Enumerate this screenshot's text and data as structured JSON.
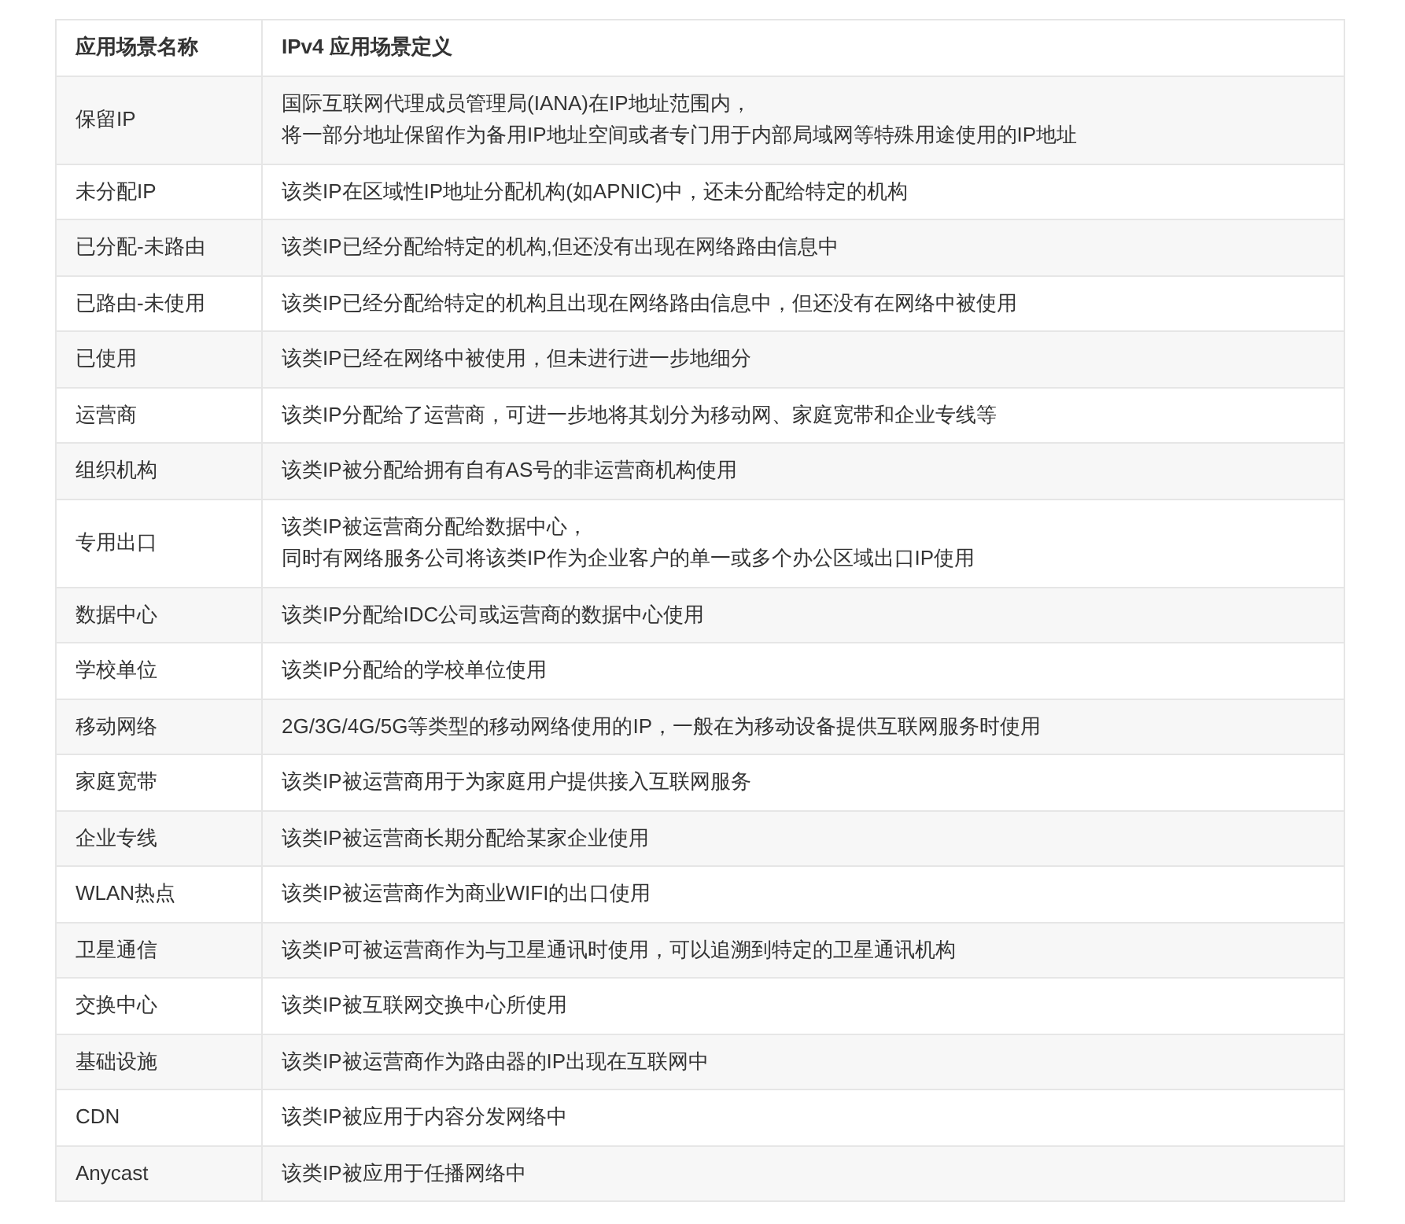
{
  "table": {
    "columns": [
      "应用场景名称",
      "IPv4 应用场景定义"
    ],
    "rows": [
      {
        "name": "保留IP",
        "definition": [
          "国际互联网代理成员管理局(IANA)在IP地址范围内，",
          "将一部分地址保留作为备用IP地址空间或者专门用于内部局域网等特殊用途使用的IP地址"
        ]
      },
      {
        "name": "未分配IP",
        "definition": [
          "该类IP在区域性IP地址分配机构(如APNIC)中，还未分配给特定的机构"
        ]
      },
      {
        "name": "已分配-未路由",
        "definition": [
          "该类IP已经分配给特定的机构,但还没有出现在网络路由信息中"
        ]
      },
      {
        "name": "已路由-未使用",
        "definition": [
          "该类IP已经分配给特定的机构且出现在网络路由信息中，但还没有在网络中被使用"
        ]
      },
      {
        "name": "已使用",
        "definition": [
          "该类IP已经在网络中被使用，但未进行进一步地细分"
        ]
      },
      {
        "name": "运营商",
        "definition": [
          "该类IP分配给了运营商，可进一步地将其划分为移动网、家庭宽带和企业专线等"
        ]
      },
      {
        "name": "组织机构",
        "definition": [
          "该类IP被分配给拥有自有AS号的非运营商机构使用"
        ]
      },
      {
        "name": "专用出口",
        "definition": [
          "该类IP被运营商分配给数据中心，",
          "同时有网络服务公司将该类IP作为企业客户的单一或多个办公区域出口IP使用"
        ]
      },
      {
        "name": "数据中心",
        "definition": [
          "该类IP分配给IDC公司或运营商的数据中心使用"
        ]
      },
      {
        "name": "学校单位",
        "definition": [
          "该类IP分配给的学校单位使用"
        ]
      },
      {
        "name": "移动网络",
        "definition": [
          "2G/3G/4G/5G等类型的移动网络使用的IP，一般在为移动设备提供互联网服务时使用"
        ]
      },
      {
        "name": "家庭宽带",
        "definition": [
          "该类IP被运营商用于为家庭用户提供接入互联网服务"
        ]
      },
      {
        "name": "企业专线",
        "definition": [
          "该类IP被运营商长期分配给某家企业使用"
        ]
      },
      {
        "name": "WLAN热点",
        "definition": [
          "该类IP被运营商作为商业WIFI的出口使用"
        ]
      },
      {
        "name": "卫星通信",
        "definition": [
          "该类IP可被运营商作为与卫星通讯时使用，可以追溯到特定的卫星通讯机构"
        ]
      },
      {
        "name": "交换中心",
        "definition": [
          "该类IP被互联网交换中心所使用"
        ]
      },
      {
        "name": "基础设施",
        "definition": [
          "该类IP被运营商作为路由器的IP出现在互联网中"
        ]
      },
      {
        "name": "CDN",
        "definition": [
          "该类IP被应用于内容分发网络中"
        ]
      },
      {
        "name": "Anycast",
        "definition": [
          "该类IP被应用于任播网络中"
        ]
      }
    ]
  }
}
